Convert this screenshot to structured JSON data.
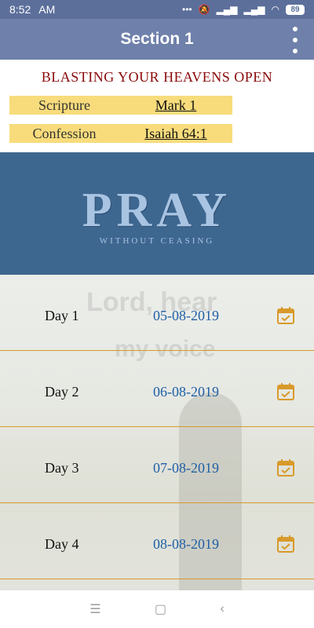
{
  "status_bar": {
    "time": "8:52",
    "ampm": "AM",
    "battery": "89",
    "icons": [
      "dots-icon",
      "mute-icon",
      "signal-icon",
      "signal-icon",
      "wifi-icon",
      "battery-icon"
    ]
  },
  "app_bar": {
    "title": "Section 1",
    "menu_icon": "more-vert-icon"
  },
  "header": {
    "title": "BLASTING YOUR HEAVENS OPEN",
    "rows": [
      {
        "label": "Scripture",
        "link": "Mark 1"
      },
      {
        "label": "Confession",
        "link": "Isaiah 64:1"
      }
    ]
  },
  "banner": {
    "main": "PRAY",
    "sub": "WITHOUT CEASING"
  },
  "days": [
    {
      "label": "Day 1",
      "date": "05-08-2019"
    },
    {
      "label": "Day 2",
      "date": "06-08-2019"
    },
    {
      "label": "Day 3",
      "date": "07-08-2019"
    },
    {
      "label": "Day 4",
      "date": "08-08-2019"
    }
  ],
  "background_text": {
    "line1": "Lord, hear",
    "line2": "my voice"
  },
  "colors": {
    "status_bar": "#5c6f9b",
    "app_bar": "#6f80ab",
    "header_title": "#8a0a0a",
    "info_row": "#f8dc7c",
    "banner": "#3e6790",
    "date_text": "#1f5fa6",
    "accent": "#d89a2a"
  },
  "nav": {
    "icons": [
      "menu-icon",
      "home-square-icon",
      "back-icon"
    ]
  }
}
